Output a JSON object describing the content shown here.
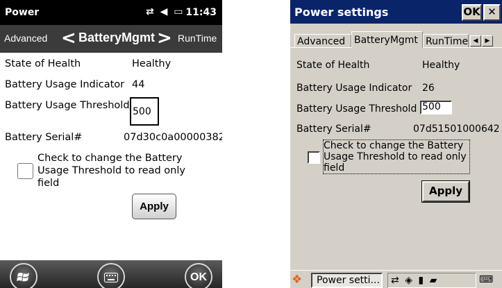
{
  "wm": {
    "status": {
      "title": "Power",
      "time": "11:43"
    },
    "tabs": {
      "left": "Advanced",
      "center": "BatteryMgmt",
      "right": "RunTime"
    },
    "fields": {
      "health_label": "State of Health",
      "health_value": "Healthy",
      "usage_label": "Battery Usage Indicator",
      "usage_value": "44",
      "threshold_label": "Battery Usage Threshold",
      "threshold_value": "500",
      "serial_label": "Battery Serial#",
      "serial_value": "07d30c0a00000382"
    },
    "checkbox_label": "Check to change the Battery Usage Threshold to read only field",
    "apply_label": "Apply",
    "bottom": {
      "ok_label": "OK"
    }
  },
  "ce": {
    "title": "Power settings",
    "ok_label": "OK",
    "close_label": "✕",
    "tabs": [
      "Advanced",
      "BatteryMgmt",
      "RunTime"
    ],
    "fields": {
      "health_label": "State of Health",
      "health_value": "Healthy",
      "usage_label": "Battery Usage Indicator",
      "usage_value": "26",
      "threshold_label": "Battery Usage Threshold",
      "threshold_value": "500",
      "serial_label": "Battery Serial#",
      "serial_value": "07d51501000642"
    },
    "checkbox_label": "Check to change the Battery Usage Threshold to read only field",
    "apply_label": "Apply",
    "taskbar": {
      "task_label": "Power setti..."
    }
  }
}
